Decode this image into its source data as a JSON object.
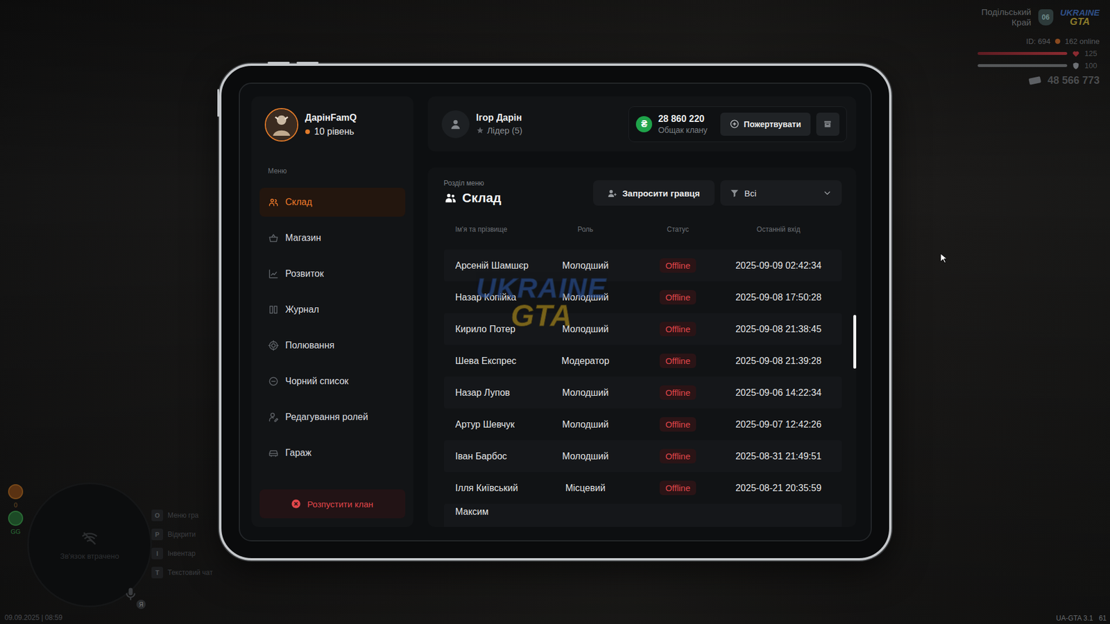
{
  "hud": {
    "region": [
      "Подільський",
      "Край"
    ],
    "region_badge": "06",
    "logo": {
      "top": "UKRAINE",
      "bottom": "GTA"
    },
    "player_id": "ID: 694",
    "online": "162 online",
    "health": {
      "reading": "125",
      "level": 1
    },
    "armor": {
      "reading": "100",
      "level": 1
    },
    "money": "48 566 773"
  },
  "status_icons": [
    "0",
    "GG"
  ],
  "minimap": {
    "message": "Зв'язок втрачено"
  },
  "hotkeys": [
    {
      "key": "O",
      "label": "Меню гра"
    },
    {
      "key": "P",
      "label": "Відкрити"
    },
    {
      "key": "I",
      "label": "Інвентар"
    },
    {
      "key": "T",
      "label": "Текстовий чат"
    }
  ],
  "voice": {
    "badge": "Я"
  },
  "datetime": "09.09.2025 | 08:59",
  "version": "UA-GTA 3.1",
  "fps": "61",
  "clan": {
    "name": "ДарінFamQ",
    "level": "10 рівень"
  },
  "menu_label": "Меню",
  "sidebar": {
    "items": [
      {
        "label": "Склад",
        "selected": true
      },
      {
        "label": "Магазин",
        "selected": false
      },
      {
        "label": "Розвиток",
        "selected": false
      },
      {
        "label": "Журнал",
        "selected": false
      },
      {
        "label": "Полювання",
        "selected": false
      },
      {
        "label": "Чорний список",
        "selected": false
      },
      {
        "label": "Редагування ролей",
        "selected": false
      },
      {
        "label": "Гараж",
        "selected": false
      }
    ]
  },
  "disband_button": "Розпустити клан",
  "leader": {
    "name": "Ігор Дарін",
    "role": "Лідер (5)"
  },
  "treasury": {
    "currency": "₴",
    "amount": "28 860 220",
    "label": "Общак клану",
    "donate_button": "Пожертвувати"
  },
  "section": {
    "caption": "Розділ меню",
    "title": "Склад"
  },
  "invite_button": "Запросити гравця",
  "filter": {
    "value": "Всі"
  },
  "table": {
    "columns": [
      "Ім'я та прізвище",
      "Роль",
      "Статус",
      "Останній вхід"
    ],
    "rows": [
      {
        "name": "Арсеній Шамшєр",
        "role": "Молодший",
        "status": "Offline",
        "last_login": "2025-09-09 02:42:34",
        "partial": false
      },
      {
        "name": "Назар Копійка",
        "role": "Молодший",
        "status": "Offline",
        "last_login": "2025-09-08 17:50:28",
        "partial": false
      },
      {
        "name": "Кирило Потер",
        "role": "Молодший",
        "status": "Offline",
        "last_login": "2025-09-08 21:38:45",
        "partial": false
      },
      {
        "name": "Шева Експрес",
        "role": "Модератор",
        "status": "Offline",
        "last_login": "2025-09-08 21:39:28",
        "partial": false
      },
      {
        "name": "Назар Лупов",
        "role": "Молодший",
        "status": "Offline",
        "last_login": "2025-09-06 14:22:34",
        "partial": false
      },
      {
        "name": "Артур Шевчук",
        "role": "Молодший",
        "status": "Offline",
        "last_login": "2025-09-07 12:42:26",
        "partial": false
      },
      {
        "name": "Іван Барбос",
        "role": "Молодший",
        "status": "Offline",
        "last_login": "2025-08-31 21:49:51",
        "partial": false
      },
      {
        "name": "Ілля Київський",
        "role": "Місцевий",
        "status": "Offline",
        "last_login": "2025-08-21 20:35:59",
        "partial": false
      },
      {
        "name": "Максим",
        "partial": true
      }
    ]
  },
  "watermark": {
    "top": "UKRAINE",
    "bottom": "GTA"
  },
  "scrollbar": {
    "offset": 0.41,
    "size": 0.15
  }
}
